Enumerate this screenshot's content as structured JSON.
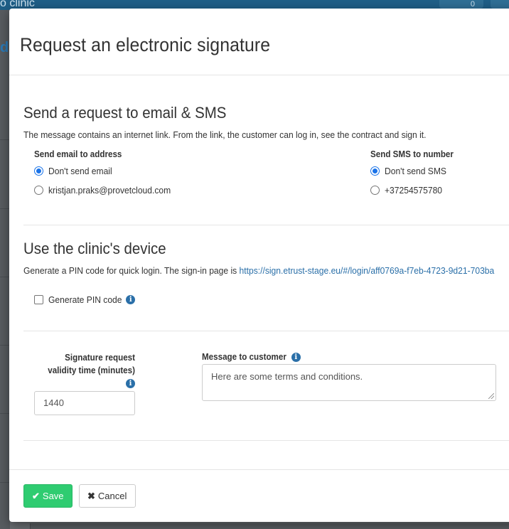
{
  "background": {
    "brand_fragment": "o clinic",
    "notification_count": "0",
    "side_letter": "d"
  },
  "modal": {
    "title": "Request an electronic signature"
  },
  "email_sms": {
    "heading": "Send a request to email & SMS",
    "description": "The message contains an internet link. From the link, the customer can log in, see the contract and sign it.",
    "email_label": "Send email to address",
    "email_options": [
      {
        "label": "Don't send email",
        "checked": true
      },
      {
        "label": "kristjan.praks@provetcloud.com",
        "checked": false
      }
    ],
    "sms_label": "Send SMS to number",
    "sms_options": [
      {
        "label": "Don't send SMS",
        "checked": true
      },
      {
        "label": "+37254575780",
        "checked": false
      }
    ]
  },
  "device": {
    "heading": "Use the clinic's device",
    "description": "Generate a PIN code for quick login. The sign-in page is ",
    "link": "https://sign.etrust-stage.eu/#/login/aff0769a-f7eb-4723-9d21-703ba",
    "pin_label": "Generate PIN code",
    "pin_checked": false
  },
  "validity": {
    "label_line1": "Signature request",
    "label_line2": "validity time (minutes)",
    "value": "1440"
  },
  "message": {
    "label": "Message to customer",
    "value": "Here are some terms and conditions."
  },
  "footer": {
    "save_label": "Save",
    "cancel_label": "Cancel"
  },
  "icons": {
    "info": "info-icon",
    "check": "check-icon",
    "close": "close-icon"
  },
  "colors": {
    "accent": "#1a73e8",
    "link": "#2a6fa8",
    "save": "#2fcc71"
  }
}
